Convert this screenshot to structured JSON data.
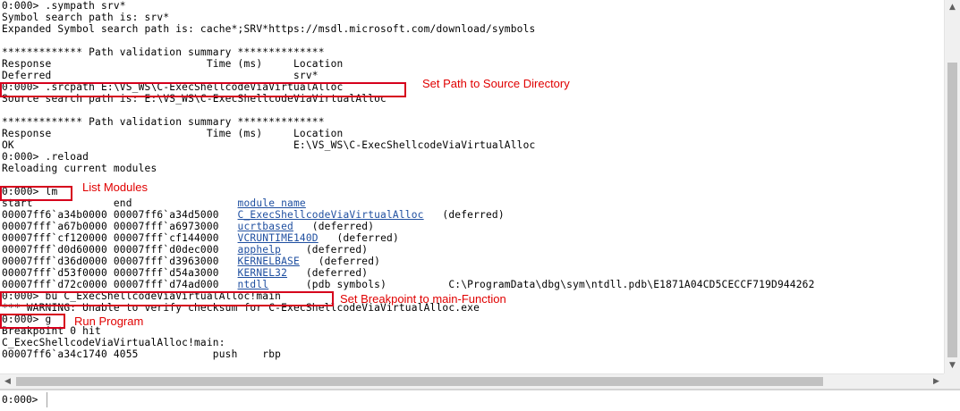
{
  "lines": [
    {
      "segs": [
        {
          "t": "0:000> .sympath srv*"
        }
      ]
    },
    {
      "segs": [
        {
          "t": "Symbol search path is: srv*"
        }
      ]
    },
    {
      "segs": [
        {
          "t": "Expanded Symbol search path is: cache*;SRV*https://msdl.microsoft.com/download/symbols"
        }
      ]
    },
    {
      "segs": [
        {
          "t": ""
        }
      ]
    },
    {
      "segs": [
        {
          "t": "************* Path validation summary **************"
        }
      ]
    },
    {
      "segs": [
        {
          "t": "Response                         Time (ms)     Location"
        }
      ]
    },
    {
      "segs": [
        {
          "t": "Deferred                                       srv*"
        }
      ]
    },
    {
      "segs": [
        {
          "t": "0:000> .srcpath E:\\VS_WS\\C-ExecShellcodeViaVirtualAlloc"
        }
      ]
    },
    {
      "segs": [
        {
          "t": "Source search path is: E:\\VS_WS\\C-ExecShellcodeViaVirtualAlloc"
        }
      ]
    },
    {
      "segs": [
        {
          "t": ""
        }
      ]
    },
    {
      "segs": [
        {
          "t": "************* Path validation summary **************"
        }
      ]
    },
    {
      "segs": [
        {
          "t": "Response                         Time (ms)     Location"
        }
      ]
    },
    {
      "segs": [
        {
          "t": "OK                                             E:\\VS_WS\\C-ExecShellcodeViaVirtualAlloc"
        }
      ]
    },
    {
      "segs": [
        {
          "t": "0:000> .reload"
        }
      ]
    },
    {
      "segs": [
        {
          "t": "Reloading current modules"
        }
      ]
    },
    {
      "segs": [
        {
          "t": ""
        }
      ]
    },
    {
      "segs": [
        {
          "t": "0:000> lm"
        }
      ]
    },
    {
      "segs": [
        {
          "t": "start             end                 "
        },
        {
          "t": "module name",
          "link": true
        }
      ]
    },
    {
      "segs": [
        {
          "t": "00007ff6`a34b0000 00007ff6`a34d5000   "
        },
        {
          "t": "C_ExecShellcodeViaVirtualAlloc",
          "link": true
        },
        {
          "t": "   (deferred)"
        }
      ]
    },
    {
      "segs": [
        {
          "t": "00007fff`a67b0000 00007fff`a6973000   "
        },
        {
          "t": "ucrtbased",
          "link": true
        },
        {
          "t": "   (deferred)"
        }
      ]
    },
    {
      "segs": [
        {
          "t": "00007fff`cf120000 00007fff`cf144000   "
        },
        {
          "t": "VCRUNTIME140D",
          "link": true
        },
        {
          "t": "   (deferred)"
        }
      ]
    },
    {
      "segs": [
        {
          "t": "00007fff`d0d60000 00007fff`d0dec000   "
        },
        {
          "t": "apphelp",
          "link": true
        },
        {
          "t": "    (deferred)"
        }
      ]
    },
    {
      "segs": [
        {
          "t": "00007fff`d36d0000 00007fff`d3963000   "
        },
        {
          "t": "KERNELBASE",
          "link": true
        },
        {
          "t": "   (deferred)"
        }
      ]
    },
    {
      "segs": [
        {
          "t": "00007fff`d53f0000 00007fff`d54a3000   "
        },
        {
          "t": "KERNEL32",
          "link": true
        },
        {
          "t": "   (deferred)"
        }
      ]
    },
    {
      "segs": [
        {
          "t": "00007fff`d72c0000 00007fff`d74ad000   "
        },
        {
          "t": "ntdll",
          "link": true
        },
        {
          "t": "      (pdb symbols)          C:\\ProgramData\\dbg\\sym\\ntdll.pdb\\E1871A04CD5CECCF719D944262"
        }
      ]
    },
    {
      "segs": [
        {
          "t": "0:000> bu C_ExecShellcodeViaVirtualAlloc!main"
        }
      ]
    },
    {
      "segs": [
        {
          "t": "*** WARNING: Unable to verify checksum for C-ExecShellcodeViaVirtualAlloc.exe"
        }
      ]
    },
    {
      "segs": [
        {
          "t": "0:000> g"
        }
      ]
    },
    {
      "segs": [
        {
          "t": "Breakpoint 0 hit"
        }
      ]
    },
    {
      "segs": [
        {
          "t": "C_ExecShellcodeViaVirtualAlloc!main:"
        }
      ]
    },
    {
      "segs": [
        {
          "t": "00007ff6`a34c1740 4055            push    rbp"
        }
      ]
    }
  ],
  "annotations": [
    {
      "name": "annotation-set-path",
      "text": "Set Path to Source Directory"
    },
    {
      "name": "annotation-list-modules",
      "text": "List Modules"
    },
    {
      "name": "annotation-set-breakpoint",
      "text": "Set Breakpoint to main-Function"
    },
    {
      "name": "annotation-run-program",
      "text": "Run Program"
    }
  ],
  "command_bar": {
    "prompt": "0:000>",
    "value": ""
  },
  "colors": {
    "annotation": "#d6001c",
    "link": "#1f4fa0"
  },
  "icons": {
    "scroll_up": "triangle-up-icon",
    "scroll_down": "triangle-down-icon",
    "scroll_left": "triangle-left-icon",
    "scroll_right": "triangle-right-icon"
  }
}
